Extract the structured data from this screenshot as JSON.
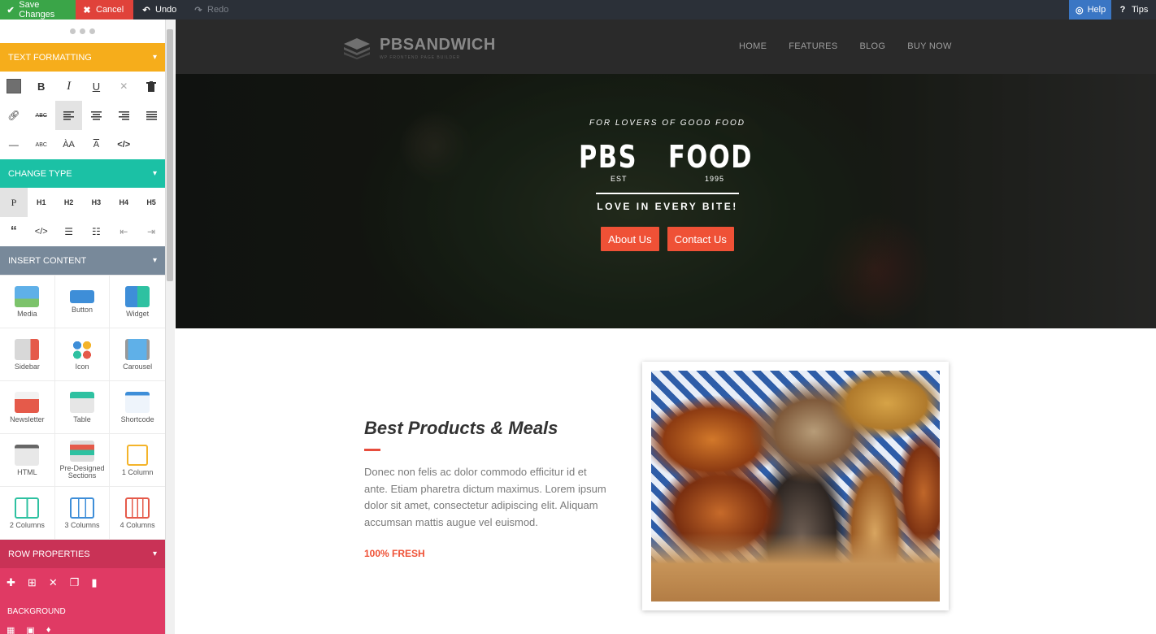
{
  "topbar": {
    "save_label": "Save Changes",
    "cancel_label": "Cancel",
    "undo_label": "Undo",
    "redo_label": "Redo",
    "help_label": "Help",
    "tips_label": "Tips"
  },
  "sidebar": {
    "text_formatting": {
      "title": "TEXT FORMATTING",
      "color": "#f6ad1b"
    },
    "change_type": {
      "title": "CHANGE TYPE",
      "color": "#1bc1a5",
      "types": [
        "P",
        "H1",
        "H2",
        "H3",
        "H4",
        "H5"
      ]
    },
    "insert_content": {
      "title": "INSERT CONTENT",
      "color": "#78899a",
      "items": [
        {
          "label": "Media",
          "icon": "media-icon"
        },
        {
          "label": "Button",
          "icon": "button-icon"
        },
        {
          "label": "Widget",
          "icon": "widget-icon"
        },
        {
          "label": "Sidebar",
          "icon": "sidebar-icon"
        },
        {
          "label": "Icon",
          "icon": "icon-icon"
        },
        {
          "label": "Carousel",
          "icon": "carousel-icon"
        },
        {
          "label": "Newsletter",
          "icon": "newsletter-icon"
        },
        {
          "label": "Table",
          "icon": "table-icon"
        },
        {
          "label": "Shortcode",
          "icon": "shortcode-icon"
        },
        {
          "label": "HTML",
          "icon": "html-icon"
        },
        {
          "label": "Pre-Designed Sections",
          "icon": "pre-designed-sections-icon"
        },
        {
          "label": "1 Column",
          "icon": "one-column-icon"
        },
        {
          "label": "2 Columns",
          "icon": "two-columns-icon"
        },
        {
          "label": "3 Columns",
          "icon": "three-columns-icon"
        },
        {
          "label": "4 Columns",
          "icon": "four-columns-icon"
        }
      ]
    },
    "row_properties": {
      "title": "ROW PROPERTIES",
      "color": "#e03a64"
    },
    "background_label": "BACKGROUND"
  },
  "site": {
    "logo_text": "PBSANDWICH",
    "logo_tagline": "WP FRONTEND PAGE BUILDER",
    "nav": [
      "HOME",
      "FEATURES",
      "BLOG",
      "BUY NOW"
    ],
    "hero": {
      "arc_text": "FOR LOVERS OF GOOD FOOD",
      "brand_left": "PBS",
      "brand_right": "FOOD",
      "est_label": "EST",
      "est_year": "1995",
      "slogan": "LOVE IN EVERY BITE!",
      "btn_about": "About Us",
      "btn_contact": "Contact Us",
      "btn_color": "#ef5136"
    },
    "content": {
      "title": "Best Products & Meals",
      "body": "Donec non felis ac dolor commodo efficitur id et ante. Etiam pharetra dictum maximus. Lorem ipsum dolor sit amet, consectetur adipiscing elit. Aliquam accumsan mattis augue vel euismod.",
      "fresh_label": "100% FRESH"
    }
  }
}
